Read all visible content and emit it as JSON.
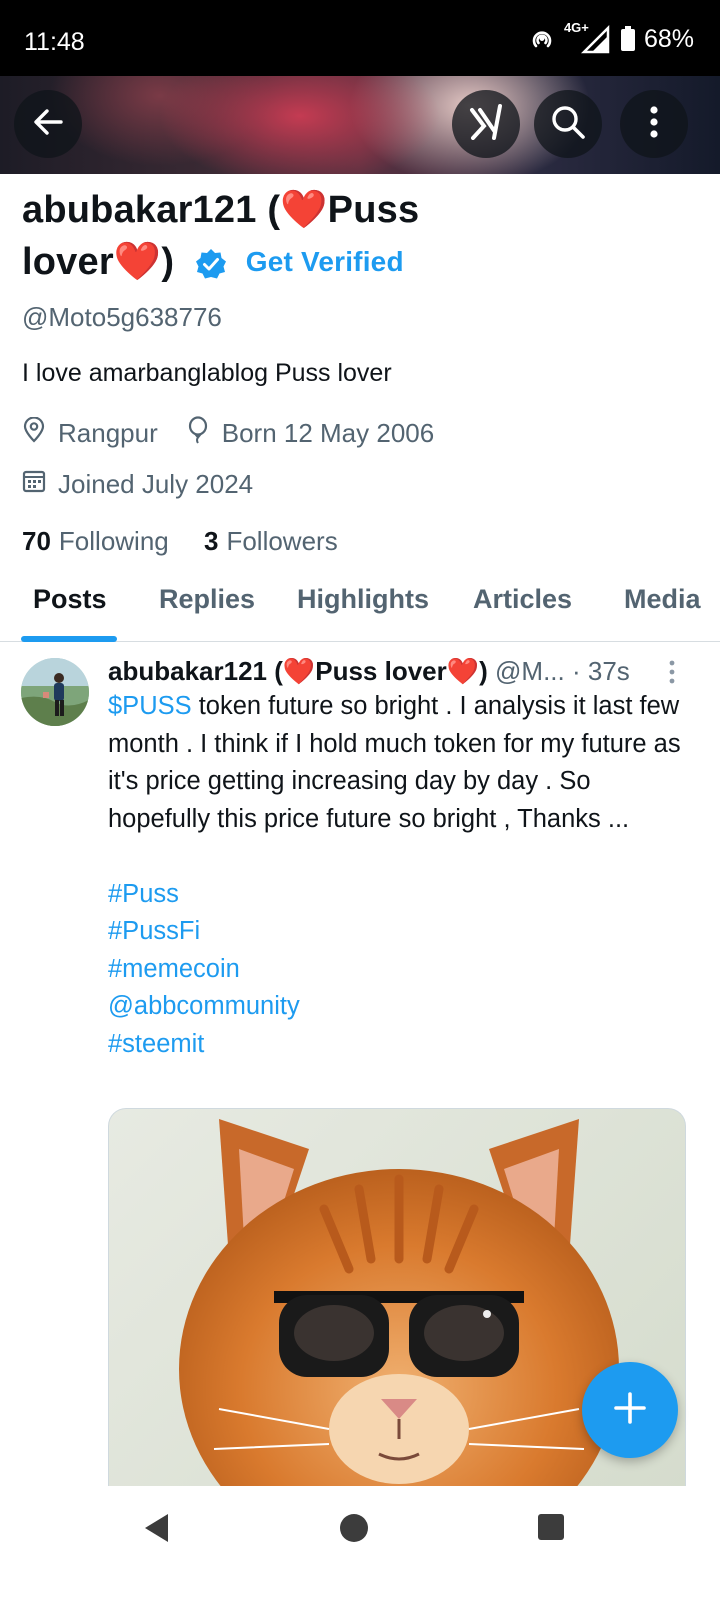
{
  "status_bar": {
    "time": "11:48",
    "network": "4G+",
    "battery": "68%",
    "icons": [
      "hotspot-icon",
      "signal-icon",
      "battery-icon"
    ]
  },
  "header": {
    "back_icon": "arrow-left-icon",
    "grok_icon": "grok-icon",
    "search_icon": "search-icon",
    "more_icon": "more-vertical-icon"
  },
  "profile": {
    "name_line1": "abubakar121 (❤️Puss",
    "name_line2": "lover❤️)",
    "get_verified": "Get Verified",
    "handle": "@Moto5g638776",
    "bio": "I love amarbanglablog  Puss lover",
    "location": "Rangpur",
    "birthday": "Born 12 May 2006",
    "joined": "Joined July 2024",
    "following_count": "70",
    "following_label": "Following",
    "followers_count": "3",
    "followers_label": "Followers"
  },
  "tabs": [
    {
      "label": "Posts",
      "active": true
    },
    {
      "label": "Replies",
      "active": false
    },
    {
      "label": "Highlights",
      "active": false
    },
    {
      "label": "Articles",
      "active": false
    },
    {
      "label": "Media",
      "active": false
    }
  ],
  "post": {
    "author_name": "abubakar121 (❤️Puss lover❤️)",
    "author_handle": "@M...",
    "time": "· 37s",
    "cashtag": "$PUSS",
    "text": " token future so bright . I analysis it last few month . I think if I hold much token for my future as it's price getting increasing day by day . So hopefully this price future so bright , Thanks ...",
    "tags": [
      "#Puss",
      "#PussFi",
      "#memecoin",
      "@abbcommunity",
      "#steemit"
    ],
    "image_subject": "orange tabby cat wearing black sunglasses"
  },
  "fab": {
    "icon": "plus-icon"
  },
  "colors": {
    "accent": "#1d9bf0",
    "text": "#0f1419",
    "secondary": "#536471",
    "heart": "#e0201e"
  }
}
